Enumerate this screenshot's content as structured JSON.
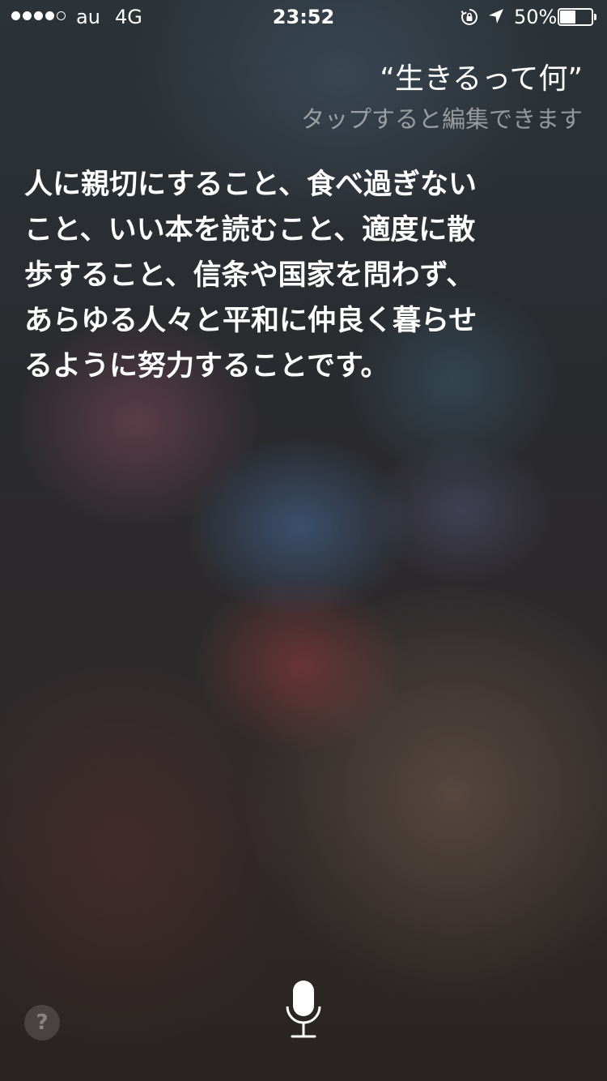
{
  "status_bar": {
    "carrier": "au",
    "network": "4G",
    "time": "23:52",
    "battery_percent": "50%",
    "battery_level": 0.5,
    "signal_bars_filled": 4,
    "signal_bars_total": 5
  },
  "siri": {
    "query": "“生きるって何”",
    "tap_to_edit_hint": "タップすると編集できます",
    "answer": "人に親切にすること、食べ過ぎないこと、いい本を読むこと、適度に散歩すること、信条や国家を問わず、あらゆる人々と平和に仲良く暮らせるように努力することです。"
  },
  "controls": {
    "help_label": "?"
  },
  "icons": {
    "lock": "rotation-lock-icon",
    "location": "location-arrow-icon",
    "battery": "battery-icon",
    "mic": "microphone-icon",
    "help": "question-mark-icon"
  },
  "colors": {
    "text_primary": "#ffffff",
    "text_secondary": "rgba(255,255,255,0.5)"
  }
}
